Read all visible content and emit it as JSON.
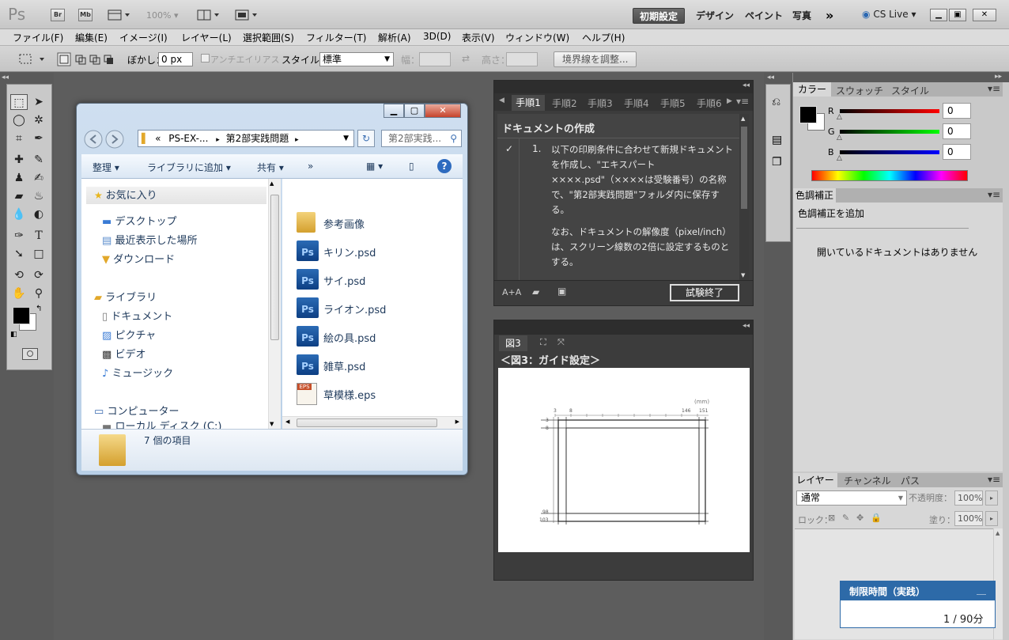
{
  "app": {
    "logo": "Ps",
    "br": "Br",
    "mb": "Mb",
    "zoom": "100%"
  },
  "workspaces": [
    "初期設定",
    "デザイン",
    "ペイント",
    "写真"
  ],
  "cs_live": "CS Live",
  "menu": [
    "ファイル(F)",
    "編集(E)",
    "イメージ(I)",
    "レイヤー(L)",
    "選択範囲(S)",
    "フィルター(T)",
    "解析(A)",
    "3D(D)",
    "表示(V)",
    "ウィンドウ(W)",
    "ヘルプ(H)"
  ],
  "options": {
    "feather_label": "ぼかし：",
    "feather_value": "0 px",
    "antialias": "アンチエイリアス",
    "style_label": "スタイル：",
    "style_value": "標準",
    "width_label": "幅：",
    "height_label": "高さ：",
    "refine": "境界線を調整..."
  },
  "explorer": {
    "address": [
      "PS-EX-...",
      "第2部実践問題"
    ],
    "search_placeholder": "第2部実践...",
    "toolbar": {
      "organize": "整理",
      "add_library": "ライブラリに追加",
      "share": "共有"
    },
    "favorites": "お気に入り",
    "nav": [
      "デスクトップ",
      "最近表示した場所",
      "ダウンロード"
    ],
    "libraries": "ライブラリ",
    "lib_items": [
      "ドキュメント",
      "ピクチャ",
      "ビデオ",
      "ミュージック"
    ],
    "computer": "コンピューター",
    "local_disk": "ローカル ディスク (C:)",
    "files": [
      {
        "name": "参考画像",
        "type": "folder"
      },
      {
        "name": "キリン.psd",
        "type": "psd"
      },
      {
        "name": "サイ.psd",
        "type": "psd"
      },
      {
        "name": "ライオン.psd",
        "type": "psd"
      },
      {
        "name": "絵の具.psd",
        "type": "psd"
      },
      {
        "name": "雑草.psd",
        "type": "psd"
      },
      {
        "name": "草模様.eps",
        "type": "eps"
      }
    ],
    "status": "7 個の項目"
  },
  "steps_panel": {
    "tabs": [
      "手順1",
      "手順2",
      "手順3",
      "手順4",
      "手順5",
      "手順6"
    ],
    "title": "ドキュメントの作成",
    "step_num": "1.",
    "body1": "以下の印刷条件に合わせて新規ドキュメントを作成し、\"エキスパート ××××.psd\"（××××は受験番号）の名称で、\"第2部実践問題\"フォルダ内に保存する。",
    "body2": "なお、ドキュメントの解像度（pixel/inch）は、スクリーン線数の2倍に設定するものとする。",
    "end_button": "試験終了"
  },
  "figure_panel": {
    "tab": "図3",
    "caption": "＜図3：ガイド設定＞",
    "fig": {
      "unit": "(mm)",
      "top_left": [
        "3",
        "8"
      ],
      "top_right": [
        "146",
        "151"
      ],
      "left_top": [
        "3",
        "8"
      ],
      "left_bottom": [
        "98",
        "103"
      ]
    }
  },
  "color_panel": {
    "tabs": [
      "カラー",
      "スウォッチ",
      "スタイル"
    ],
    "r_label": "R",
    "g_label": "G",
    "b_label": "B",
    "r": "0",
    "g": "0",
    "b": "0"
  },
  "adjust_panel": {
    "tab": "色調補正",
    "add": "色調補正を追加",
    "empty": "開いているドキュメントはありません"
  },
  "layers_panel": {
    "tabs": [
      "レイヤー",
      "チャンネル",
      "パス"
    ],
    "blend": "通常",
    "opacity_label": "不透明度：",
    "opacity": "100%",
    "lock_label": "ロック：",
    "fill_label": "塗り：",
    "fill": "100%"
  },
  "timer": {
    "title": "制限時間（実践）",
    "minimize": "＿",
    "value": "1 / 90分"
  }
}
